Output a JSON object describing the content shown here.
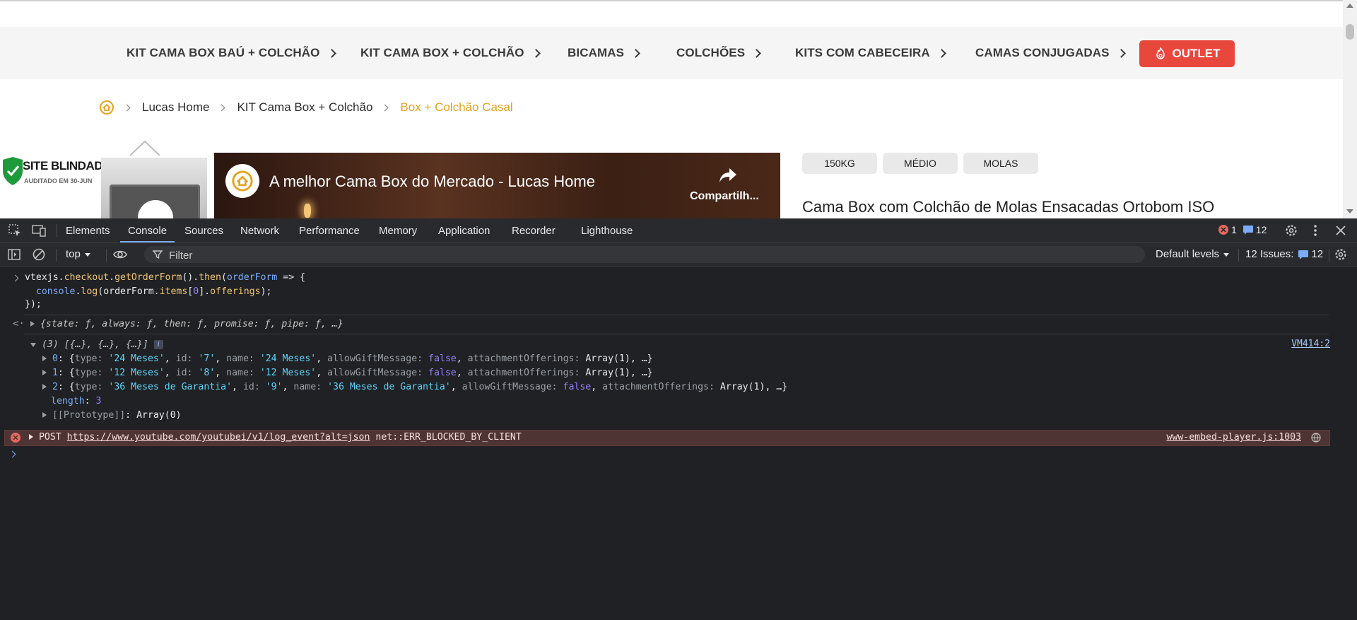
{
  "site": {
    "nav": [
      {
        "label": "KIT CAMA BOX BAÚ + COLCHÃO"
      },
      {
        "label": "KIT CAMA BOX + COLCHÃO"
      },
      {
        "label": "BICAMAS"
      },
      {
        "label": "COLCHÕES"
      },
      {
        "label": "KITS COM CABECEIRA"
      },
      {
        "label": "CAMAS CONJUGADAS"
      }
    ],
    "outlet_label": "OUTLET",
    "breadcrumb": [
      "Lucas Home",
      "KIT Cama Box + Colchão",
      "Box + Colchão Casal"
    ],
    "seal_title": "SITE BLINDADO",
    "seal_subtitle": "AUDITADO EM 30-JUN",
    "video_title": "A melhor Cama Box do Mercado - Lucas Home",
    "video_share": "Compartilh...",
    "tags": [
      "150KG",
      "MÉDIO",
      "MOLAS"
    ],
    "product_title": "Cama Box com Colchão de Molas Ensacadas Ortobom ISO",
    "colors": {
      "accent": "#e6a21b",
      "outlet": "#e8473c"
    }
  },
  "devtools": {
    "tabs": [
      "Elements",
      "Console",
      "Sources",
      "Network",
      "Performance",
      "Memory",
      "Application",
      "Recorder",
      "Lighthouse"
    ],
    "active_tab": "Console",
    "error_count": "1",
    "message_count": "12",
    "toolbar": {
      "context": "top",
      "filter_placeholder": "Filter",
      "levels": "Default levels",
      "issues_label": "12 Issues:",
      "issues_count": "12"
    },
    "console": {
      "input_lines": [
        "vtexjs.checkout.getOrderForm().then(orderForm => {",
        "  console.log(orderForm.items[0].offerings);",
        "});"
      ],
      "promise_result": "{state: ƒ, always: ƒ, then: ƒ, promise: ƒ, pipe: ƒ, …}",
      "array_header": "(3) [{…}, {…}, {…}]",
      "array_source": "VM414:2",
      "items": [
        {
          "index": "0",
          "type": "'24 Meses'",
          "id": "'7'",
          "name": "'24 Meses'",
          "allowGiftMessage": "false",
          "attachmentOfferings": "Array(1), …}"
        },
        {
          "index": "1",
          "type": "'12 Meses'",
          "id": "'8'",
          "name": "'12 Meses'",
          "allowGiftMessage": "false",
          "attachmentOfferings": "Array(1), …}"
        },
        {
          "index": "2",
          "type": "'36 Meses de Garantia'",
          "id": "'9'",
          "name": "'36 Meses de Garantia'",
          "allowGiftMessage": "false",
          "attachmentOfferings": "Array(1), …}"
        }
      ],
      "length_key": "length",
      "length_value": "3",
      "prototype_key": "[[Prototype]]",
      "prototype_value": "Array(0)",
      "error": {
        "method": "POST",
        "url": "https://www.youtube.com/youtubei/v1/log_event?alt=json",
        "message": "net::ERR_BLOCKED_BY_CLIENT",
        "source": "www-embed-player.js:1003"
      }
    }
  }
}
